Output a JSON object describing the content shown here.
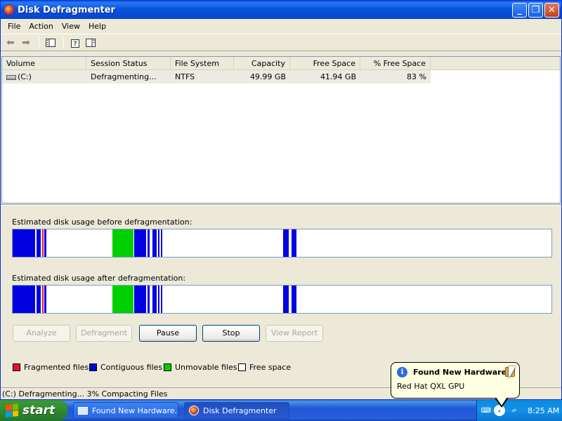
{
  "window": {
    "title": "Disk Defragmenter",
    "minimize": "_",
    "maximize": "❐",
    "close": "✕"
  },
  "menu": [
    "File",
    "Action",
    "View",
    "Help"
  ],
  "toolbar": {
    "icons": [
      "back-arrow-icon",
      "forward-arrow-icon",
      "console-tree-icon",
      "help-icon",
      "properties-icon"
    ]
  },
  "listview": {
    "columns": [
      "Volume",
      "Session Status",
      "File System",
      "Capacity",
      "Free Space",
      "% Free Space"
    ],
    "rows": [
      {
        "volume": "(C:)",
        "status": "Defragmenting...",
        "fs": "NTFS",
        "capacity": "49.99 GB",
        "free": "41.94 GB",
        "pct": "83 %"
      }
    ]
  },
  "analysis": {
    "before_label": "Estimated disk usage before defragmentation:",
    "after_label": "Estimated disk usage after defragmentation:"
  },
  "buttons": {
    "analyze": "Analyze",
    "defragment": "Defragment",
    "pause": "Pause",
    "stop": "Stop",
    "view_report": "View Report"
  },
  "legend": {
    "fragmented": "Fragmented files",
    "contiguous": "Contiguous files",
    "unmovable": "Unmovable files",
    "free": "Free space"
  },
  "colors": {
    "fragmented": "#e8112d",
    "contiguous": "#0000e0",
    "unmovable": "#00d000",
    "free": "#ffffff"
  },
  "status": "(C:) Defragmenting... 3%  Compacting Files",
  "taskbar": {
    "start": "start",
    "tasks": [
      "Found New Hardware...",
      "Disk Defragmenter"
    ],
    "time": "8:25 AM"
  },
  "balloon": {
    "title": "Found New Hardware",
    "message": "Red Hat QXL GPU"
  }
}
